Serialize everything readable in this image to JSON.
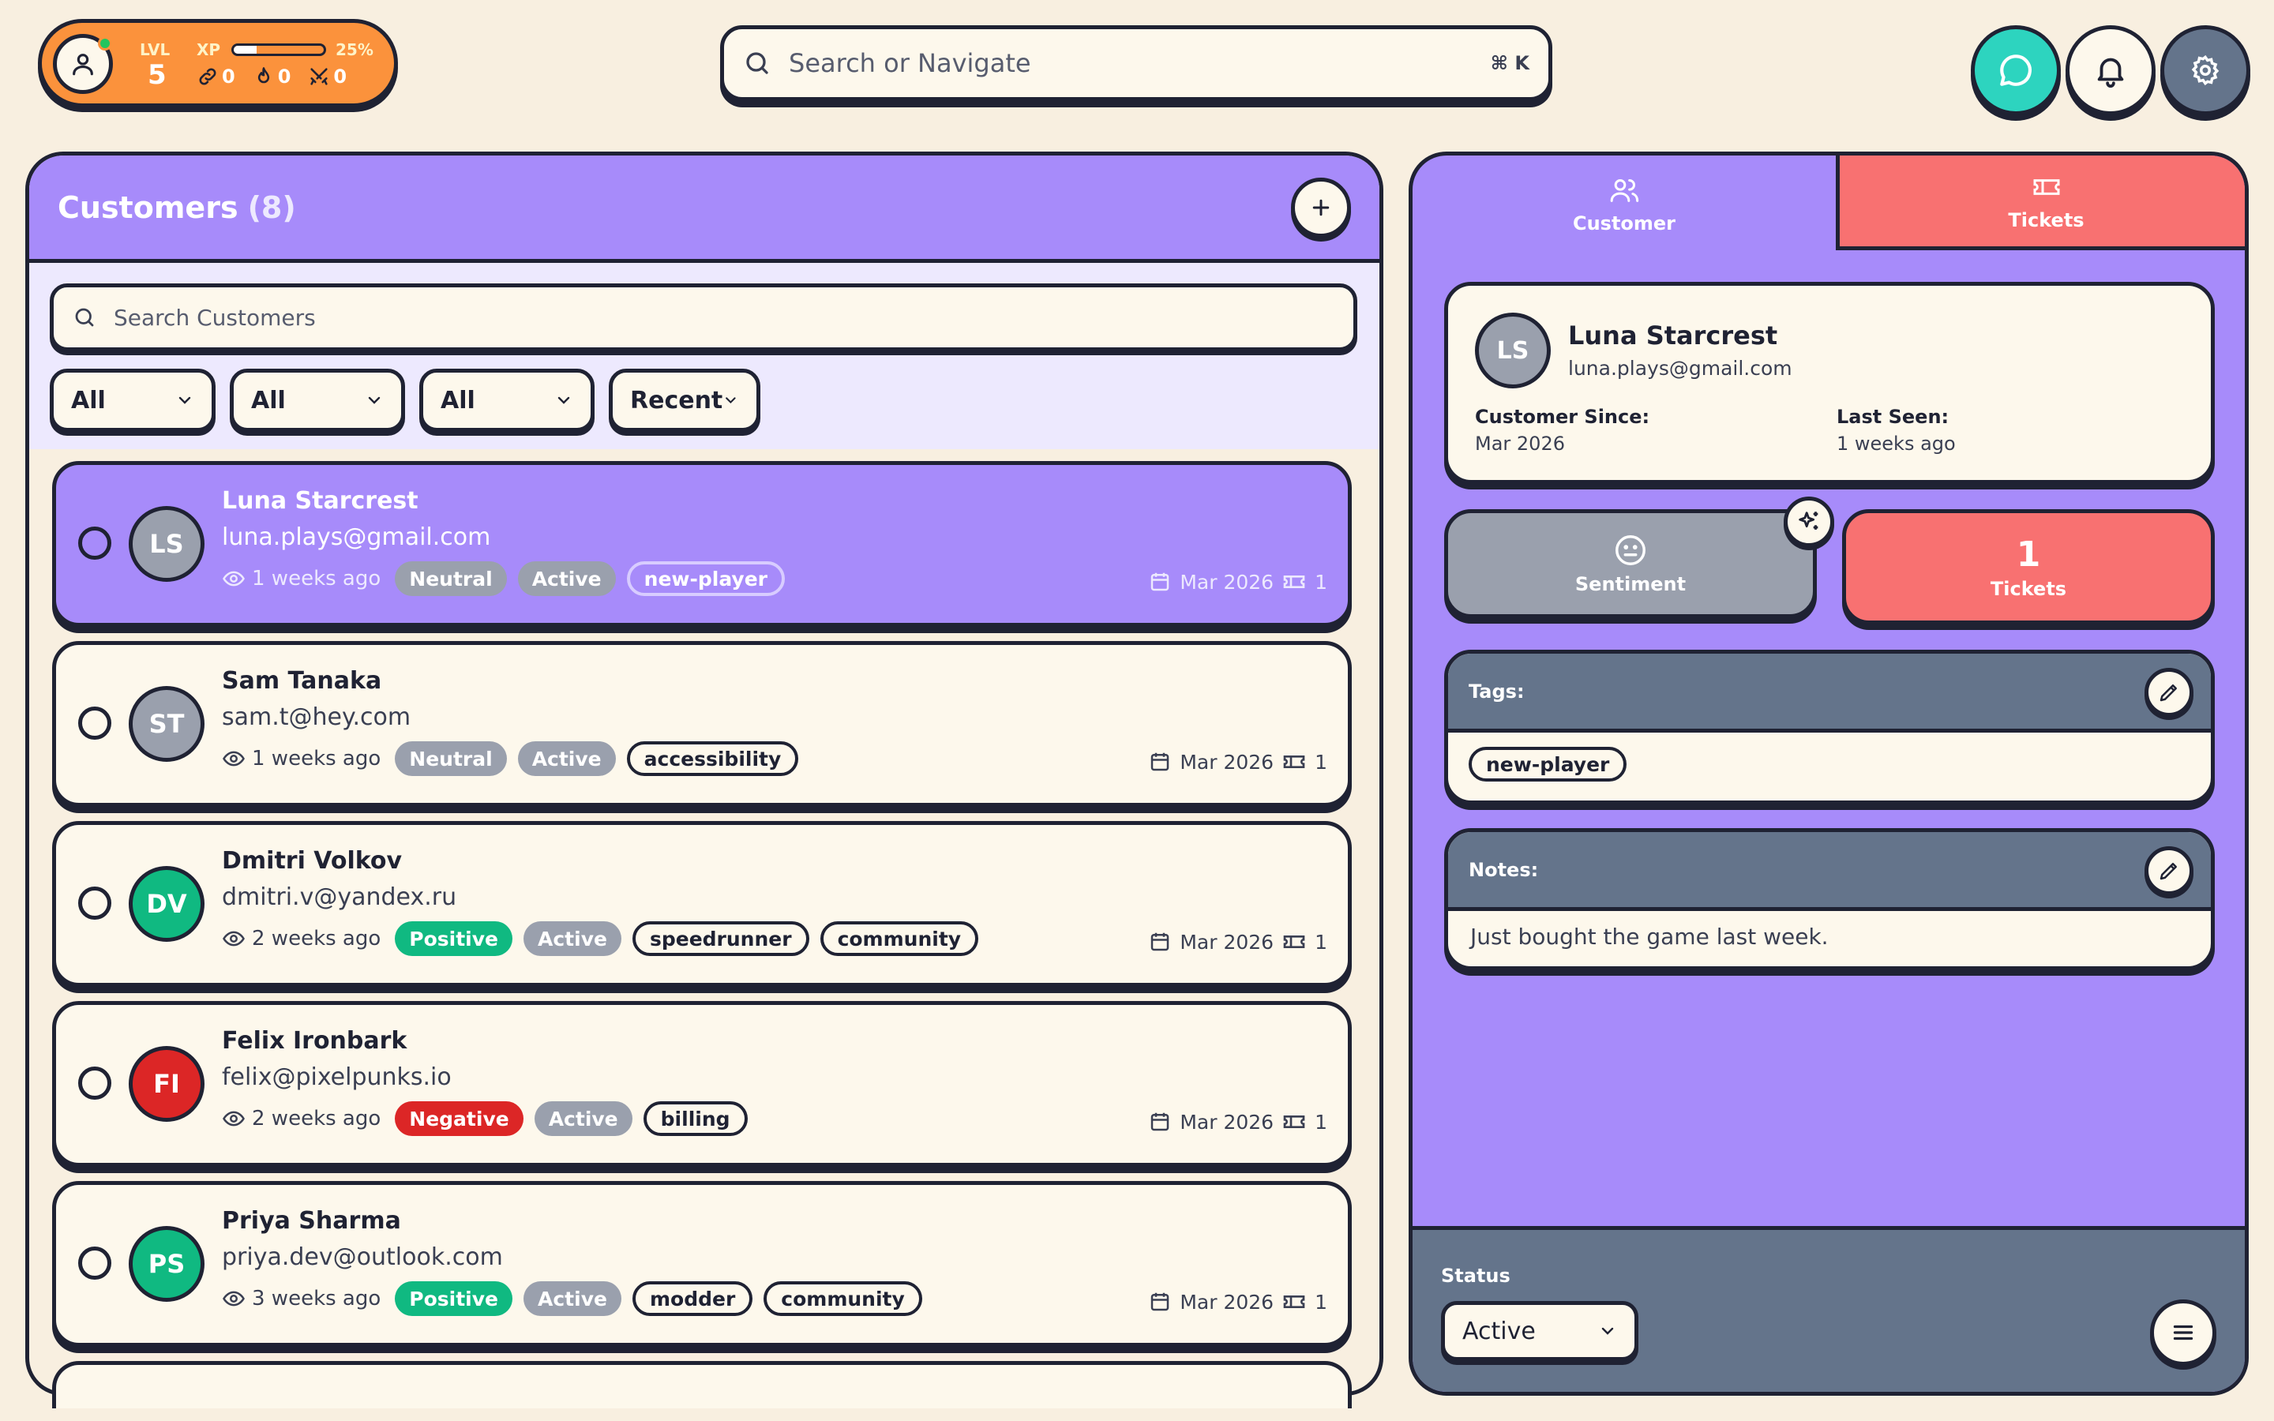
{
  "player": {
    "lvl_label": "LVL",
    "level": "5",
    "xp_label": "XP",
    "xp_percent_text": "25%",
    "xp_fraction": 0.25,
    "stats": [
      {
        "icon": "link-icon",
        "value": "0"
      },
      {
        "icon": "flame-icon",
        "value": "0"
      },
      {
        "icon": "swords-icon",
        "value": "0"
      }
    ]
  },
  "search": {
    "placeholder": "Search or Navigate",
    "shortcut": "⌘ K"
  },
  "top_buttons": {
    "chat_icon": "chat-icon",
    "bell_icon": "bell-icon",
    "settings_icon": "gear-icon",
    "chat_color": "#2dd4bf",
    "bell_color": "#fdf8ec",
    "settings_color": "#64748b"
  },
  "customers": {
    "title": "Customers",
    "count": "(8)",
    "search_placeholder": "Search Customers",
    "filters": [
      "All",
      "All",
      "All",
      "Recent"
    ],
    "list": [
      {
        "initials": "LS",
        "name": "Luna Starcrest",
        "email": "luna.plays@gmail.com",
        "last_seen": "1 weeks ago",
        "sentiment": "Neutral",
        "sentiment_kind": "neutral",
        "status": "Active",
        "tags": [
          "new-player"
        ],
        "date": "Mar 2026",
        "tickets": "1",
        "avatar_color": "#9aa0ad",
        "selected": true
      },
      {
        "initials": "ST",
        "name": "Sam Tanaka",
        "email": "sam.t@hey.com",
        "last_seen": "1 weeks ago",
        "sentiment": "Neutral",
        "sentiment_kind": "neutral",
        "status": "Active",
        "tags": [
          "accessibility"
        ],
        "date": "Mar 2026",
        "tickets": "1",
        "avatar_color": "#9aa0ad",
        "selected": false
      },
      {
        "initials": "DV",
        "name": "Dmitri Volkov",
        "email": "dmitri.v@yandex.ru",
        "last_seen": "2 weeks ago",
        "sentiment": "Positive",
        "sentiment_kind": "positive",
        "status": "Active",
        "tags": [
          "speedrunner",
          "community"
        ],
        "date": "Mar 2026",
        "tickets": "1",
        "avatar_color": "#10b981",
        "selected": false
      },
      {
        "initials": "FI",
        "name": "Felix Ironbark",
        "email": "felix@pixelpunks.io",
        "last_seen": "2 weeks ago",
        "sentiment": "Negative",
        "sentiment_kind": "negative",
        "status": "Active",
        "tags": [
          "billing"
        ],
        "date": "Mar 2026",
        "tickets": "1",
        "avatar_color": "#dc2626",
        "selected": false
      },
      {
        "initials": "PS",
        "name": "Priya Sharma",
        "email": "priya.dev@outlook.com",
        "last_seen": "3 weeks ago",
        "sentiment": "Positive",
        "sentiment_kind": "positive",
        "status": "Active",
        "tags": [
          "modder",
          "community"
        ],
        "date": "Mar 2026",
        "tickets": "1",
        "avatar_color": "#10b981",
        "selected": false
      }
    ]
  },
  "detail": {
    "tabs": {
      "customer": "Customer",
      "tickets": "Tickets"
    },
    "profile": {
      "initials": "LS",
      "name": "Luna Starcrest",
      "email": "luna.plays@gmail.com",
      "since_label": "Customer Since:",
      "since_value": "Mar 2026",
      "seen_label": "Last Seen:",
      "seen_value": "1 weeks ago"
    },
    "sentiment_label": "Sentiment",
    "tickets_count": "1",
    "tickets_label": "Tickets",
    "tags_title": "Tags:",
    "tags": [
      "new-player"
    ],
    "notes_title": "Notes:",
    "notes": "Just bought the game last week.",
    "status_label": "Status",
    "status_value": "Active"
  },
  "colors": {
    "background": "#f8efe0",
    "purple": "#a78bfa",
    "coral": "#f87171",
    "orange": "#fb923c",
    "teal": "#2dd4bf",
    "slate": "#64748b"
  }
}
